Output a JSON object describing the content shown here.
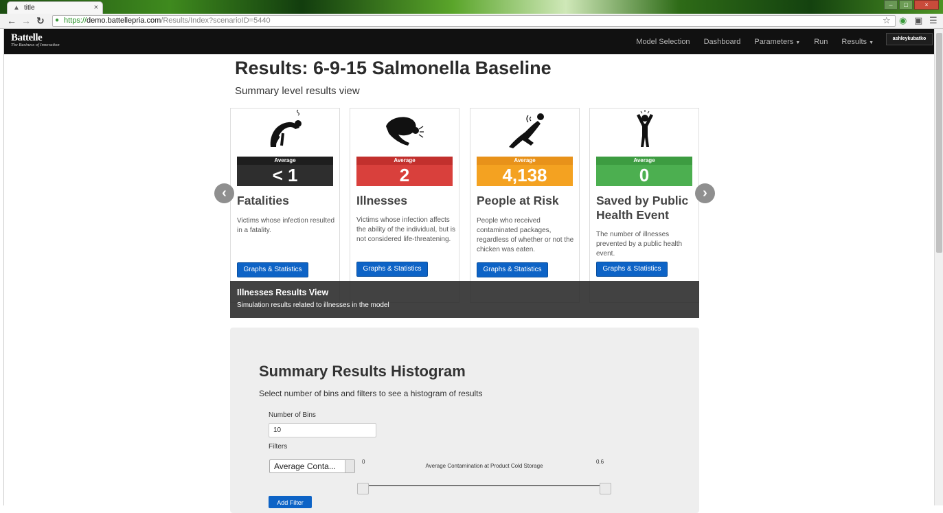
{
  "browser": {
    "tab_title": "title",
    "url_scheme": "https://",
    "url_host": "demo.battellepria.com",
    "url_path": "/Results/Index?scenarioID=5440",
    "icons": [
      "back-icon",
      "forward-icon",
      "reload-icon",
      "lock-icon",
      "star-icon",
      "extension-icon",
      "cast-icon",
      "menu-icon"
    ]
  },
  "nav": {
    "brand_name": "Battelle",
    "brand_tagline": "The Business of Innovation",
    "links": [
      "Model Selection",
      "Dashboard",
      "Parameters",
      "Run",
      "Results"
    ],
    "user": "ashleykubatko"
  },
  "page": {
    "title": "Results: 6-9-15 Salmonella Baseline",
    "subtitle": "Summary level results view"
  },
  "cards": [
    {
      "avg_label": "Average",
      "value": "< 1",
      "title": "Fatalities",
      "description": "Victims whose infection resulted in a fatality.",
      "button": "Graphs & Statistics",
      "color": "#2e2e2e",
      "icon": "fatality-figure-icon"
    },
    {
      "avg_label": "Average",
      "value": "2",
      "title": "Illnesses",
      "description": "Victims whose infection affects the ability of the individual, but is not considered life-threatening.",
      "button": "Graphs & Statistics",
      "color": "#d9403c",
      "icon": "ill-figure-icon"
    },
    {
      "avg_label": "Average",
      "value": "4,138",
      "title": "People at Risk",
      "description": "People who received contaminated packages, regardless of whether or not the chicken was eaten.",
      "button": "Graphs & Statistics",
      "color": "#f4a221",
      "icon": "at-risk-figure-icon"
    },
    {
      "avg_label": "Average",
      "value": "0",
      "title": "Saved by Public Health Event",
      "description": "The number of illnesses prevented by a public health event.",
      "button": "Graphs & Statistics",
      "color": "#4caf50",
      "icon": "saved-figure-icon"
    }
  ],
  "carousel": {
    "caption_title": "Illnesses Results View",
    "caption_text": "Simulation results related to illnesses in the model",
    "prev_icon": "‹",
    "next_icon": "›"
  },
  "histogram": {
    "title": "Summary Results Histogram",
    "subtitle": "Select number of bins and filters to see a histogram of results",
    "bins_label": "Number of Bins",
    "bins_value": "10",
    "filters_label": "Filters",
    "filter_selected": "Average Conta...",
    "slider_min": "0",
    "slider_max": "0.6",
    "slider_label": "Average Contamination at Product Cold Storage",
    "add_filter": "Add Filter"
  }
}
